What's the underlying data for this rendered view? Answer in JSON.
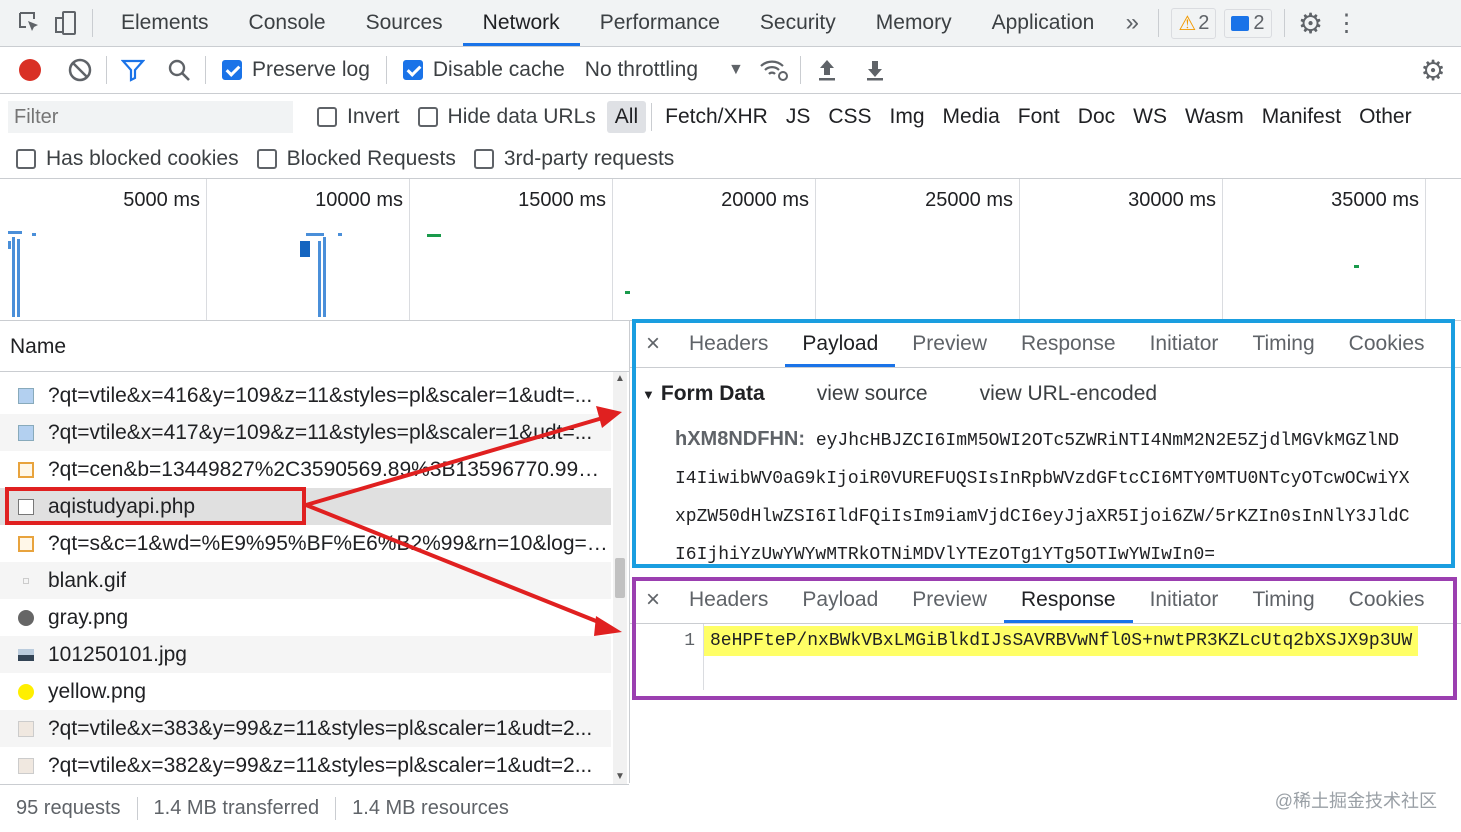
{
  "tabbar": {
    "tabs": [
      "Elements",
      "Console",
      "Sources",
      "Network",
      "Performance",
      "Security",
      "Memory",
      "Application"
    ],
    "warnings": "2",
    "messages": "2"
  },
  "toolbar": {
    "preserve_log": "Preserve log",
    "disable_cache": "Disable cache",
    "throttling": "No throttling"
  },
  "filter": {
    "placeholder": "Filter",
    "invert": "Invert",
    "hide_data_urls": "Hide data URLs",
    "types": [
      "All",
      "Fetch/XHR",
      "JS",
      "CSS",
      "Img",
      "Media",
      "Font",
      "Doc",
      "WS",
      "Wasm",
      "Manifest",
      "Other"
    ]
  },
  "cookies": {
    "has_blocked": "Has blocked cookies",
    "blocked_requests": "Blocked Requests",
    "third_party": "3rd-party requests"
  },
  "timeline": {
    "ticks": [
      "5000 ms",
      "10000 ms",
      "15000 ms",
      "20000 ms",
      "25000 ms",
      "30000 ms",
      "35000 ms"
    ]
  },
  "requests": {
    "header": "Name",
    "items": [
      {
        "name": "?qt=vtile&x=416&y=109&z=11&styles=pl&scaler=1&udt=...",
        "icon": "image-icon"
      },
      {
        "name": "?qt=vtile&x=417&y=109&z=11&styles=pl&scaler=1&udt=...",
        "icon": "image-icon"
      },
      {
        "name": "?qt=cen&b=13449827%2C3590569.89%3B13596770.99%2C...",
        "icon": "script-icon"
      },
      {
        "name": "aqistudyapi.php",
        "icon": "document-icon"
      },
      {
        "name": "?qt=s&c=1&wd=%E9%95%BF%E6%B2%99&rn=10&log=ce...",
        "icon": "script-icon"
      },
      {
        "name": "blank.gif",
        "icon": "image-icon"
      },
      {
        "name": "gray.png",
        "icon": "image-icon"
      },
      {
        "name": "101250101.jpg",
        "icon": "image-icon"
      },
      {
        "name": "yellow.png",
        "icon": "image-icon"
      },
      {
        "name": "?qt=vtile&x=383&y=99&z=11&styles=pl&scaler=1&udt=2...",
        "icon": "image-icon"
      },
      {
        "name": "?qt=vtile&x=382&y=99&z=11&styles=pl&scaler=1&udt=2...",
        "icon": "image-icon"
      }
    ]
  },
  "status": {
    "requests": "95 requests",
    "transferred": "1.4 MB transferred",
    "resources": "1.4 MB resources"
  },
  "detail_tabs": [
    "Headers",
    "Payload",
    "Preview",
    "Response",
    "Initiator",
    "Timing",
    "Cookies"
  ],
  "payload": {
    "section": "Form Data",
    "view_source": "view source",
    "view_url_encoded": "view URL-encoded",
    "key": "hXM8NDFHN:",
    "lines": [
      "eyJhcHBJZCI6ImM5OWI2OTc5ZWRiNTI4NmM2N2E5ZjdlMGVkMGZlND",
      "I4IiwibWV0aG9kIjoiR0VUREFUQSIsInRpbWVzdGFtcCI6MTY0MTU0NTcyOTcwOCwiYX",
      "xpZW50dHlwZSI6IldFQiIsIm9iamVjdCI6eyJjaXR5Ijoi6ZW/5rKZIn0sInNlY3JldC",
      "I6IjhiYzUwYWYwMTRkOTNiMDVlYTEzOTg1YTg5OTIwYWIwIn0="
    ]
  },
  "response": {
    "line_number": "1",
    "content": "8eHPFteP/nxBWkVBxLMGiBlkdIJsSAVRBVwNfl0S+nwtPR3KZLcUtq2bXSJX9p3UW"
  },
  "colors": {
    "accent": "#1a73e8",
    "annotation_red": "#e02020",
    "annotation_blue": "#1a9ee0",
    "annotation_purple": "#9b3fb0",
    "highlight_yellow": "#ffff66"
  },
  "watermark": "@稀土掘金技术社区"
}
